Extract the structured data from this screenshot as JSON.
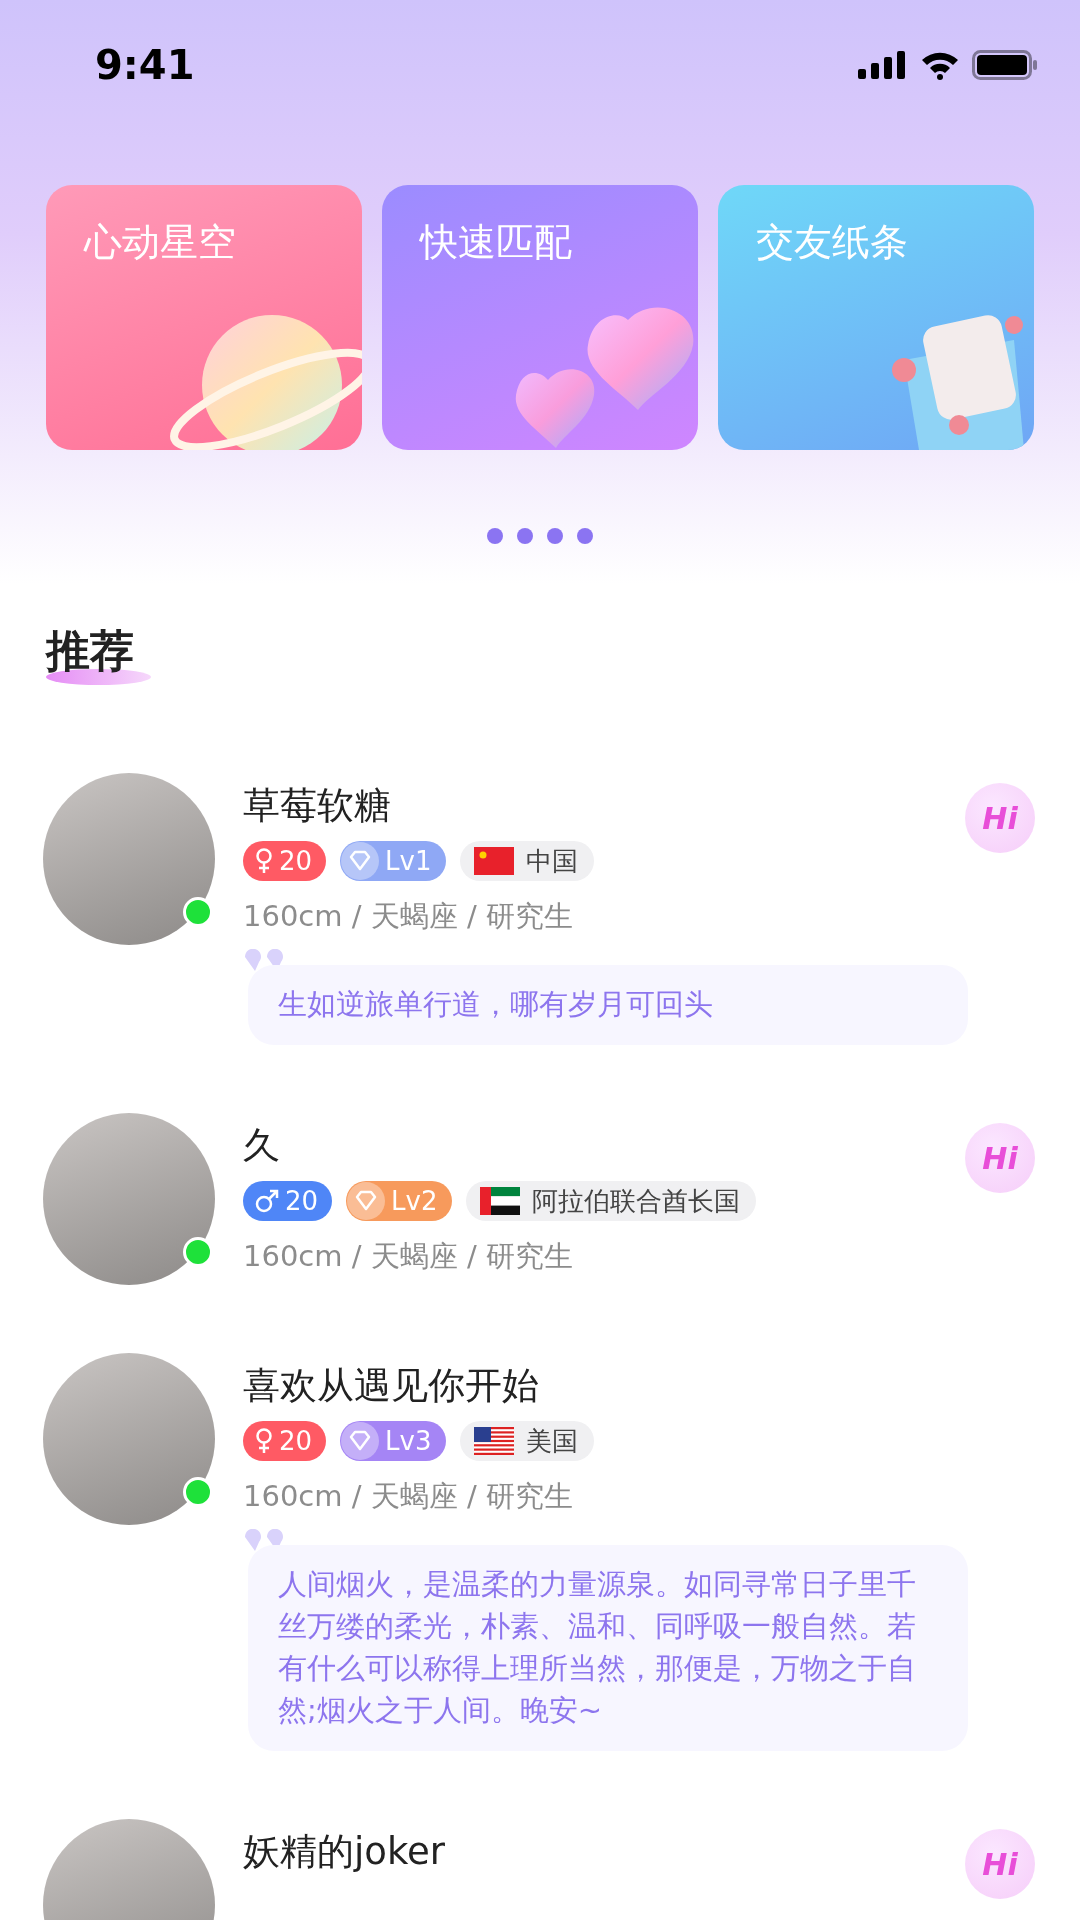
{
  "status_bar": {
    "time": "9:41"
  },
  "banners": [
    {
      "title": "心动星空",
      "kind": "planet"
    },
    {
      "title": "快速匹配",
      "kind": "hearts"
    },
    {
      "title": "交友纸条",
      "kind": "envelope"
    }
  ],
  "section": {
    "title": "推荐"
  },
  "users": [
    {
      "name": "草莓软糖",
      "online": true,
      "gender_badge": {
        "kind": "female",
        "text": "20"
      },
      "level_badge": {
        "text": "Lv1",
        "color": "#8fa8f5"
      },
      "country_badge": {
        "kind": "cn",
        "text": "中国"
      },
      "info": "160cm / 天蝎座 / 研究生",
      "quote": "生如逆旅单行道，哪有岁月可回头",
      "hi": "Hi"
    },
    {
      "name": "久",
      "online": true,
      "gender_badge": {
        "kind": "male",
        "text": "20"
      },
      "level_badge": {
        "text": "Lv2",
        "color": "#f79a5c"
      },
      "country_badge": {
        "kind": "ae",
        "text": "阿拉伯联合酋长国"
      },
      "info": "160cm / 天蝎座 / 研究生",
      "hi": "Hi"
    },
    {
      "name": "喜欢从遇见你开始",
      "online": true,
      "gender_badge": {
        "kind": "female",
        "text": "20"
      },
      "level_badge": {
        "text": "Lv3",
        "color": "#a585f5"
      },
      "country_badge": {
        "kind": "us",
        "text": "美国"
      },
      "info": "160cm / 天蝎座 / 研究生",
      "quote": "人间烟火，是温柔的力量源泉。如同寻常日子里千丝万缕的柔光，朴素、温和、同呼吸一般自然。若有什么可以称得上理所当然，那便是，万物之于自然;烟火之于人间。晚安~"
    },
    {
      "name": "妖精的joker",
      "hi": "Hi"
    }
  ]
}
